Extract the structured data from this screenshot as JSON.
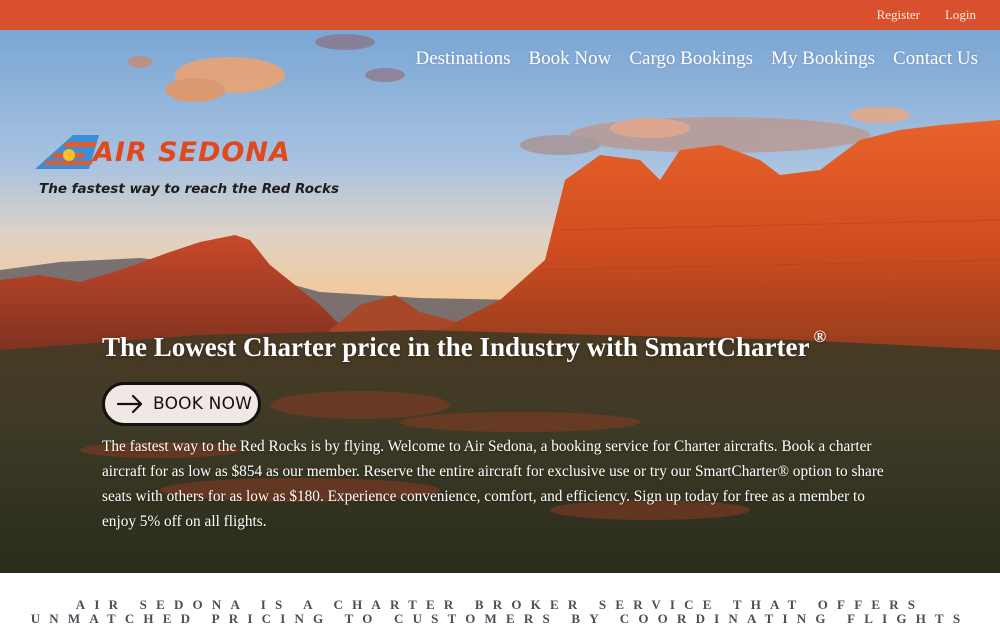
{
  "colors": {
    "topbar": "#d9502e",
    "logo_red": "#e0481f",
    "button_bg": "#f1e7e4",
    "mission_text": "#4b4f5a"
  },
  "topbar": {
    "links": [
      {
        "label": "Register"
      },
      {
        "label": "Login"
      }
    ]
  },
  "nav": {
    "items": [
      {
        "label": "Destinations"
      },
      {
        "label": "Book Now"
      },
      {
        "label": "Cargo Bookings"
      },
      {
        "label": "My Bookings"
      },
      {
        "label": "Contact Us"
      }
    ]
  },
  "logo": {
    "wordmark": "AIR SEDONA",
    "tagline": "The fastest way to reach the Red Rocks",
    "icon": "tail-fin-icon"
  },
  "hero": {
    "headline": "The Lowest Charter price in the Industry with SmartCharter",
    "headline_mark": "®",
    "cta": {
      "label": "BOOK NOW",
      "icon": "arrow-right-icon"
    },
    "intro": "The fastest way to the Red Rocks is by flying. Welcome to Air Sedona, a booking service for Charter aircrafts. Book a charter aircraft for as low as $854 as our member. Reserve the entire aircraft for exclusive use or try our SmartCharter® option to share seats with others for as low as $180. Experience convenience, comfort, and efficiency. Sign up today for free as a member to enjoy 5% off on all flights."
  },
  "mission": {
    "text": "Air Sedona is a charter broker service that offers unmatched pricing to customers by coordinating flights"
  }
}
